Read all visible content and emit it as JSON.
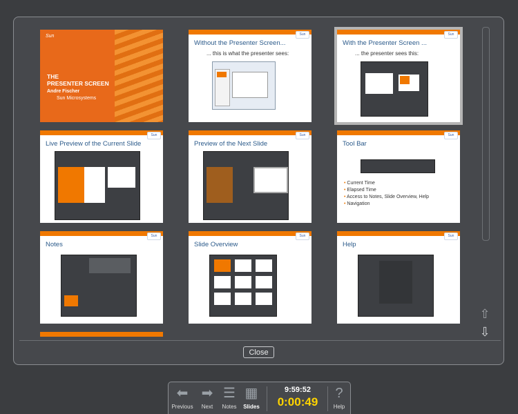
{
  "slides": [
    {
      "title": "",
      "kind": "title",
      "line1": "THE",
      "line2": "PRESENTER SCREEN",
      "author": "Andre Fischer",
      "company": "Sun Microsystems",
      "logo": "Sun"
    },
    {
      "title": "Without the Presenter Screen...",
      "sub": "... this is what the presenter sees:"
    },
    {
      "title": "With the Presenter Screen ...",
      "sub": "... the presenter sees this:"
    },
    {
      "title": "Live Preview of the Current Slide"
    },
    {
      "title": "Preview of the Next Slide"
    },
    {
      "title": "Tool Bar",
      "bullets": [
        "Current Time",
        "Elapsed Time",
        "Access to Notes, Slide Overview, Help",
        "Navigation"
      ]
    },
    {
      "title": "Notes"
    },
    {
      "title": "Slide Overview"
    },
    {
      "title": "Help"
    }
  ],
  "close_label": "Close",
  "toolbar": {
    "previous": "Previous",
    "next": "Next",
    "notes": "Notes",
    "slides": "Slides",
    "help": "Help",
    "time": "9:59:52",
    "elapsed": "0:00:49"
  }
}
